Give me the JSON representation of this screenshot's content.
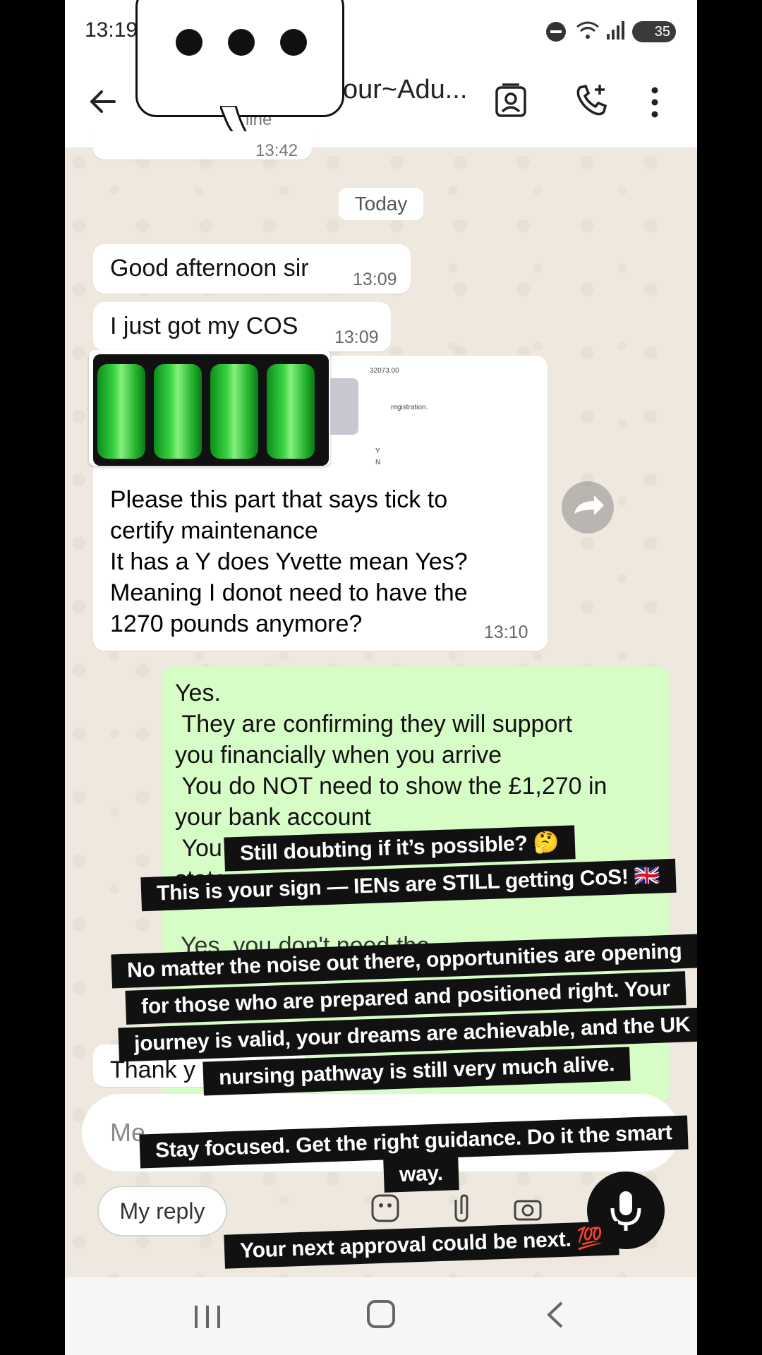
{
  "status_bar": {
    "time": "13:19",
    "battery": "35",
    "signal_label": "6"
  },
  "app_bar": {
    "title": "our~Adu...",
    "subtitle": "line"
  },
  "previous_message": {
    "time": "13:42"
  },
  "date_chip": "Today",
  "messages": [
    {
      "id": "m1",
      "direction": "in",
      "text": "Good afternoon sir",
      "time": "13:09"
    },
    {
      "id": "m2",
      "direction": "in",
      "text": "I just got my COS",
      "time": "13:09"
    },
    {
      "id": "m3",
      "direction": "in",
      "type": "image",
      "image_snippets": {
        "amount": "32073.00",
        "word": "registration.",
        "y": "Y",
        "n": "N"
      },
      "caption": "Please this part that says tick to\ncertify maintenance\nIt has a Y does Yvette mean Yes?\nMeaning I donot need to have the\n1270 pounds anymore?",
      "time": "13:10"
    },
    {
      "id": "m4",
      "direction": "out",
      "text": "Yes.\n They are confirming they will support\nyou financially when you arrive\n You do NOT need to show the £1,270 in\nyour bank account\n You",
      "partial_lines": [
        "state",
        "Yes, you don't need the",
        "Thank y"
      ]
    }
  ],
  "composer": {
    "placeholder": "Me",
    "quick_reply": "My reply"
  },
  "captions": {
    "line1": "Still doubting if it’s possible? 🤔",
    "line2": "This is your sign — IENs are STILL getting CoS! 🇬🇧",
    "line3": "No matter the noise out there, opportunities are opening",
    "line4": "for those who are prepared and positioned right. Your",
    "line5": "journey is valid, your dreams are achievable, and the UK",
    "line6": "nursing pathway is still very much alive.",
    "line7": "Stay focused. Get the right guidance. Do it the smart",
    "line8": "way.",
    "line9": "Your next approval could be next. 💯"
  },
  "colors": {
    "outgoing_bubble": "#d6fdc6",
    "incoming_bubble": "#ffffff",
    "caption_bg": "#111111"
  },
  "icons": [
    "back-arrow-icon",
    "contact-card-icon",
    "add-call-icon",
    "more-vert-icon",
    "forward-icon",
    "mic-icon",
    "sticker-icon",
    "attach-icon",
    "camera-icon"
  ]
}
